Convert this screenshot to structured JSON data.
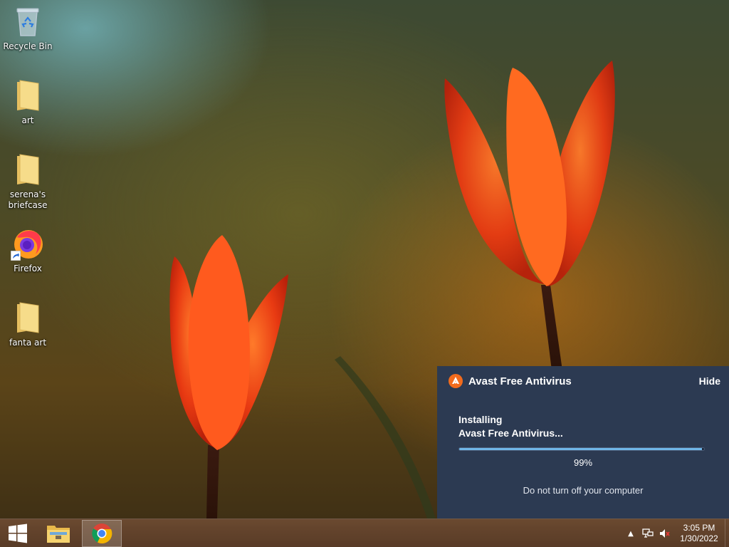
{
  "desktop": {
    "icons": [
      {
        "label": "Recycle Bin",
        "icon": "recycle-bin-icon"
      },
      {
        "label": "art",
        "icon": "folder-icon"
      },
      {
        "label": "serena's briefcase",
        "icon": "folder-icon"
      },
      {
        "label": "Firefox",
        "icon": "firefox-icon"
      },
      {
        "label": "fanta art",
        "icon": "folder-icon"
      }
    ]
  },
  "avast": {
    "title": "Avast Free Antivirus",
    "hide_label": "Hide",
    "status_line1": "Installing",
    "status_line2": "Avast Free Antivirus...",
    "progress": 99,
    "progress_text": "99%",
    "warning": "Do not turn off your computer",
    "accent": "#f26b1d"
  },
  "taskbar": {
    "items": [
      "windows-start-icon",
      "file-explorer-icon",
      "chrome-icon"
    ],
    "tray": {
      "icons": [
        "chevron-up-icon",
        "network-icon",
        "volume-muted-icon"
      ],
      "time": "3:05 PM",
      "date": "1/30/2022"
    }
  }
}
